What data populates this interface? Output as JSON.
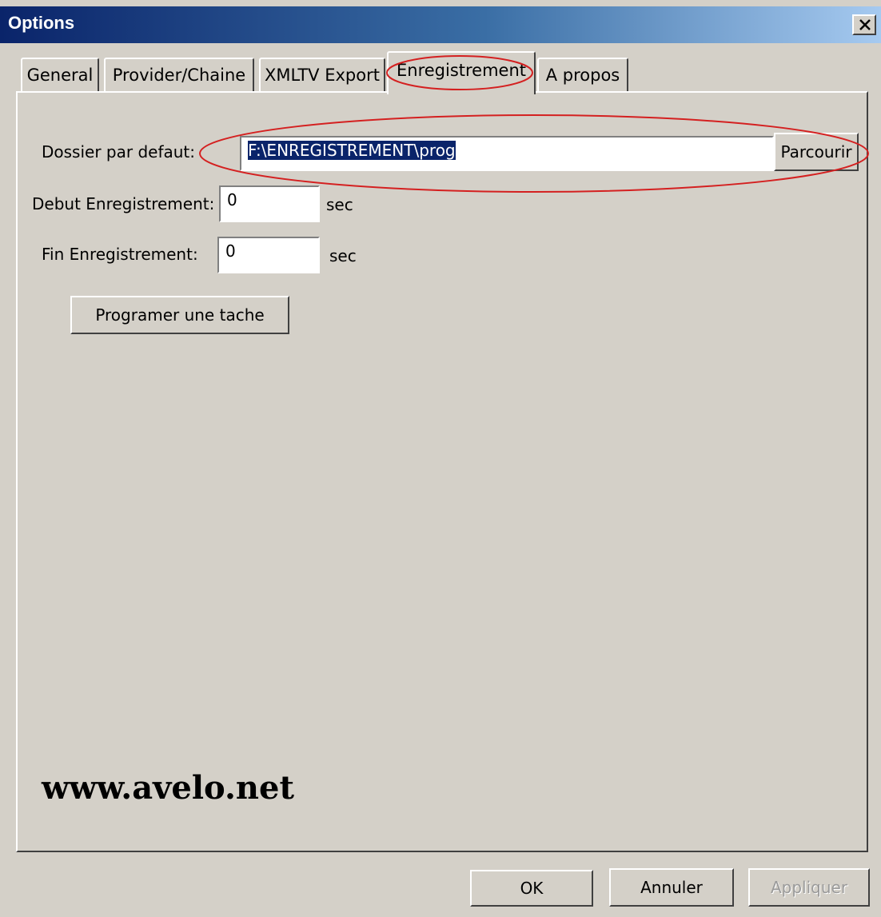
{
  "window": {
    "title": "Options",
    "close_icon": "close-icon"
  },
  "tabs": [
    {
      "label": "General",
      "active": false
    },
    {
      "label": "Provider/Chaine",
      "active": false
    },
    {
      "label": "XMLTV Export",
      "active": false
    },
    {
      "label": "Enregistrement",
      "active": true
    },
    {
      "label": "A propos",
      "active": false
    }
  ],
  "recording": {
    "folder_label": "Dossier par defaut:",
    "folder_value": "F:\\ENREGISTREMENT\\prog",
    "browse_label": "Parcourir",
    "start_label": "Debut Enregistrement:",
    "start_value": "0",
    "start_unit": "sec",
    "end_label": "Fin Enregistrement:",
    "end_value": "0",
    "end_unit": "sec",
    "schedule_label": "Programer une tache"
  },
  "watermark": "www.avelo.net",
  "footer": {
    "ok_label": "OK",
    "cancel_label": "Annuler",
    "apply_label": "Appliquer"
  },
  "colors": {
    "title_bar": "#0a246a",
    "selection": "#0a246a",
    "annotation": "#d42020"
  }
}
